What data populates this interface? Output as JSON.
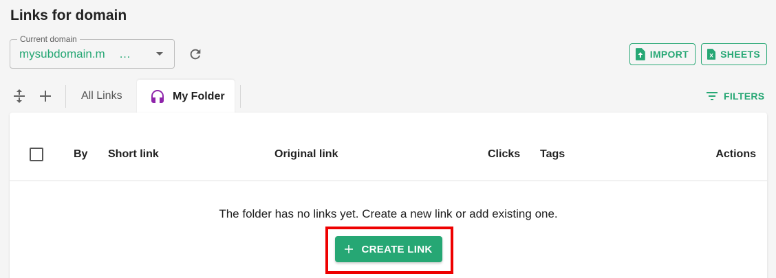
{
  "page": {
    "title": "Links for domain"
  },
  "domain_select": {
    "label": "Current domain",
    "value": "mysubdomain.m",
    "ellipsis": "…"
  },
  "toolbar": {
    "import_label": "IMPORT",
    "sheets_label": "SHEETS",
    "filters_label": "FILTERS"
  },
  "tabs": [
    {
      "label": "All Links",
      "active": false
    },
    {
      "label": "My Folder",
      "active": true
    }
  ],
  "table": {
    "columns": [
      "By",
      "Short link",
      "Original link",
      "Clicks",
      "Tags",
      "Actions"
    ],
    "empty_message": "The folder has no links yet. Create a new link or add existing one.",
    "create_label": "CREATE LINK"
  },
  "colors": {
    "accent": "#26a774",
    "folder_icon": "#8e24aa",
    "highlight": "#ee0000"
  },
  "icons": [
    "refresh-icon",
    "file-upload-icon",
    "excel-sheet-icon",
    "expand-collapse-icon",
    "plus-icon",
    "headphones-icon",
    "filter-icon"
  ]
}
